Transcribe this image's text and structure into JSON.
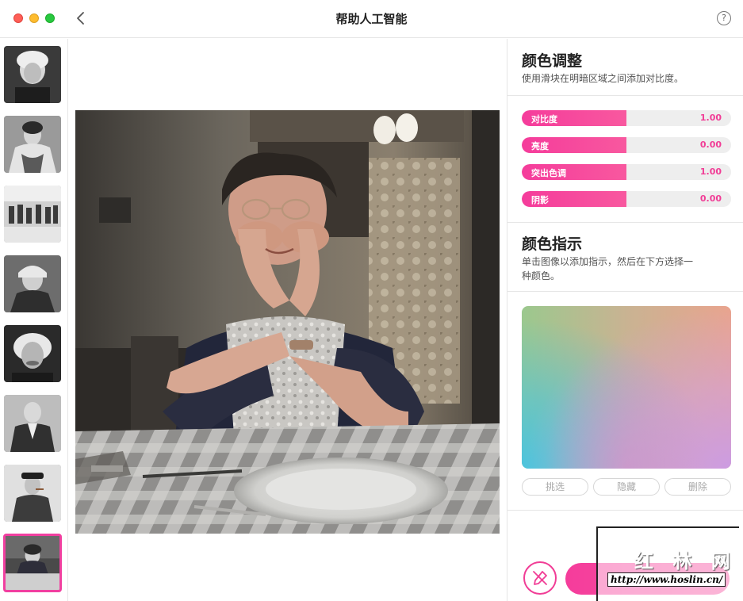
{
  "window": {
    "title": "帮助人工智能",
    "help_label": "?"
  },
  "thumbnails": [
    {
      "subject": "portrait woman with short curly hair"
    },
    {
      "subject": "woman with fur collar"
    },
    {
      "subject": "group of people in snow"
    },
    {
      "subject": "man in winter hat"
    },
    {
      "subject": "man with white hair"
    },
    {
      "subject": "elderly man in suit"
    },
    {
      "subject": "man with cigar in coat"
    },
    {
      "subject": "woman at table",
      "selected": true
    }
  ],
  "adjust": {
    "title": "颜色调整",
    "description": "使用滑块在明暗区域之间添加对比度。",
    "sliders": [
      {
        "label": "对比度",
        "value": "1.00"
      },
      {
        "label": "亮度",
        "value": "0.00"
      },
      {
        "label": "突出色调",
        "value": "1.00"
      },
      {
        "label": "阴影",
        "value": "0.00"
      }
    ]
  },
  "hints": {
    "title": "颜色指示",
    "description_line1": "单击图像以添加指示，然后在下方选择一",
    "description_line2": "种颜色。",
    "buttons": {
      "pick": "挑选",
      "hide": "隐藏",
      "delete": "删除"
    }
  },
  "watermark": {
    "text_cn": "红 林 网",
    "url": "http://www.hoslin.cn/"
  },
  "colors": {
    "accent": "#f13d96",
    "slider_track": "#eeeeee"
  }
}
